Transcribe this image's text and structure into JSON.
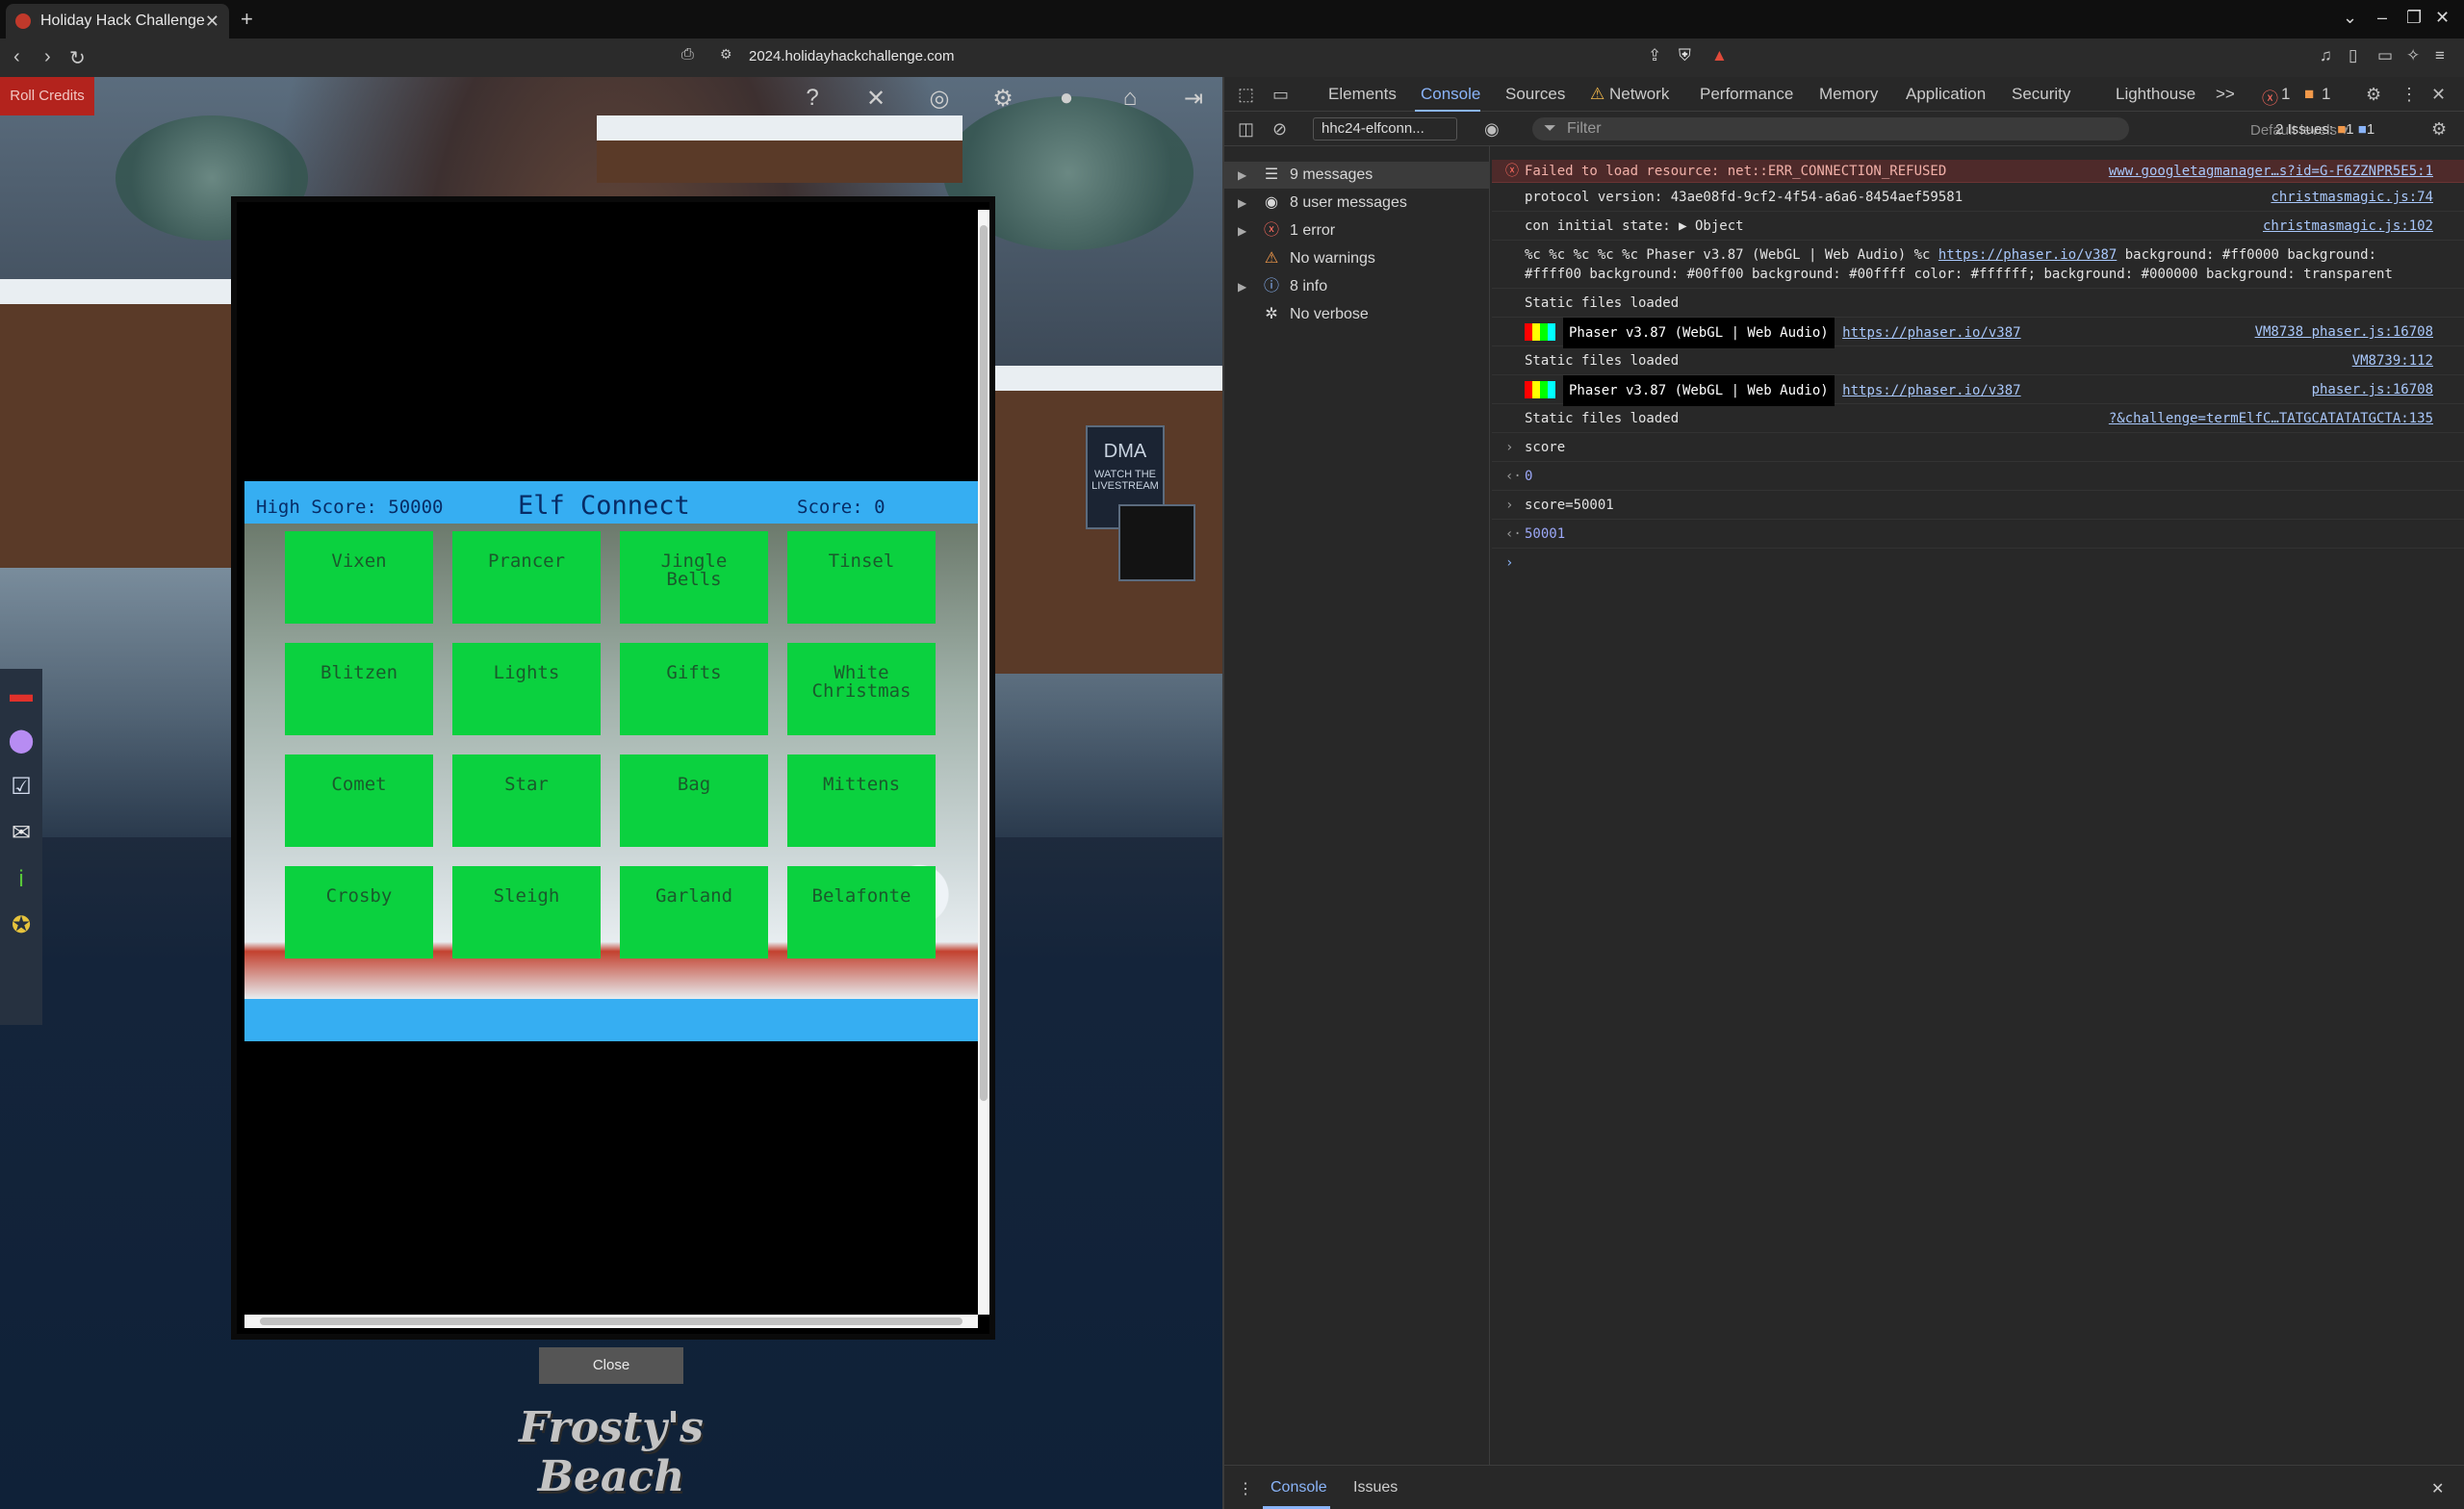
{
  "browser": {
    "tab_title": "Holiday Hack Challenge",
    "new_tab": "+",
    "url": "2024.holidayhackchallenge.com"
  },
  "game_ui": {
    "roll_credits": "Roll Credits",
    "close_label": "Close",
    "location": "Frosty's Beach",
    "signs": [
      "DMA",
      "WATCH THE LIVESTREAM"
    ]
  },
  "game": {
    "high_score_label": "High Score: 50000",
    "title": "Elf Connect",
    "score_label": "Score: 0",
    "cards": [
      "Vixen",
      "Prancer",
      "Jingle\nBells",
      "Tinsel",
      "Blitzen",
      "Lights",
      "Gifts",
      "White\nChristmas",
      "Comet",
      "Star",
      "Bag",
      "Mittens",
      "Crosby",
      "Sleigh",
      "Garland",
      "Belafonte"
    ]
  },
  "devtools": {
    "tabs": [
      "Elements",
      "Console",
      "Sources",
      "Network",
      "Performance",
      "Memory",
      "Application",
      "Security",
      "Lighthouse"
    ],
    "more": ">>",
    "error_count": "1",
    "warning_count": "1",
    "context": "hhc24-elfconn...",
    "filter_placeholder": "Filter",
    "default_levels": "Default levels ▾",
    "issues_label": "2 Issues:",
    "issues_err": "1",
    "issues_info": "1",
    "sidebar": [
      {
        "label": "9 messages",
        "icon": "list-icon",
        "glyph": "☰"
      },
      {
        "label": "8 user messages",
        "icon": "user-icon",
        "glyph": "◉"
      },
      {
        "label": "1 error",
        "icon": "error-icon",
        "glyph": "ⓧ"
      },
      {
        "label": "No warnings",
        "icon": "warning-icon",
        "glyph": "⚠"
      },
      {
        "label": "8 info",
        "icon": "info-icon",
        "glyph": "ⓘ"
      },
      {
        "label": "No verbose",
        "icon": "bug-icon",
        "glyph": "✲"
      }
    ],
    "console": {
      "r1_text": "Failed to load resource: net::ERR_CONNECTION_REFUSED",
      "r1_src": "www.googletagmanager…s?id=G-F6ZZNPR5E5:1",
      "r2_text": "protocol version: 43ae08fd-9cf2-4f54-a6a6-8454aef59581",
      "r2_src": "christmasmagic.js:74",
      "r3_text": "con initial state: ▶ Object",
      "r3_src": "christmasmagic.js:102",
      "r4_line1_pre": "%c %c %c %c %c Phaser v3.87 (WebGL | Web Audio) %c ",
      "r4_link": "https://phaser.io/v387",
      "r4_line1_post": " background: #ff0000 background:",
      "r4_line2": "#ffff00 background: #00ff00 background: #00ffff color: #ffffff; background: #000000 background: transparent",
      "r5_text": "Static files loaded",
      "r6_phaser": "Phaser v3.87 (WebGL | Web Audio)",
      "r6_link": "https://phaser.io/v387",
      "r6_src": "VM8738 phaser.js:16708",
      "r7_text": "Static files loaded",
      "r7_src": "VM8739:112",
      "r8_phaser": "Phaser v3.87 (WebGL | Web Audio)",
      "r8_link": "https://phaser.io/v387",
      "r8_src": "phaser.js:16708",
      "r9_text": "Static files loaded",
      "r9_src": "?&challenge=termElfC…TATGCATATATGCTA:135",
      "r10_text": "score",
      "r11_text": "0",
      "r12_text": "score=50001",
      "r13_text": "50001",
      "r14_text": ""
    },
    "drawer_console": "Console",
    "drawer_issues": "Issues"
  }
}
